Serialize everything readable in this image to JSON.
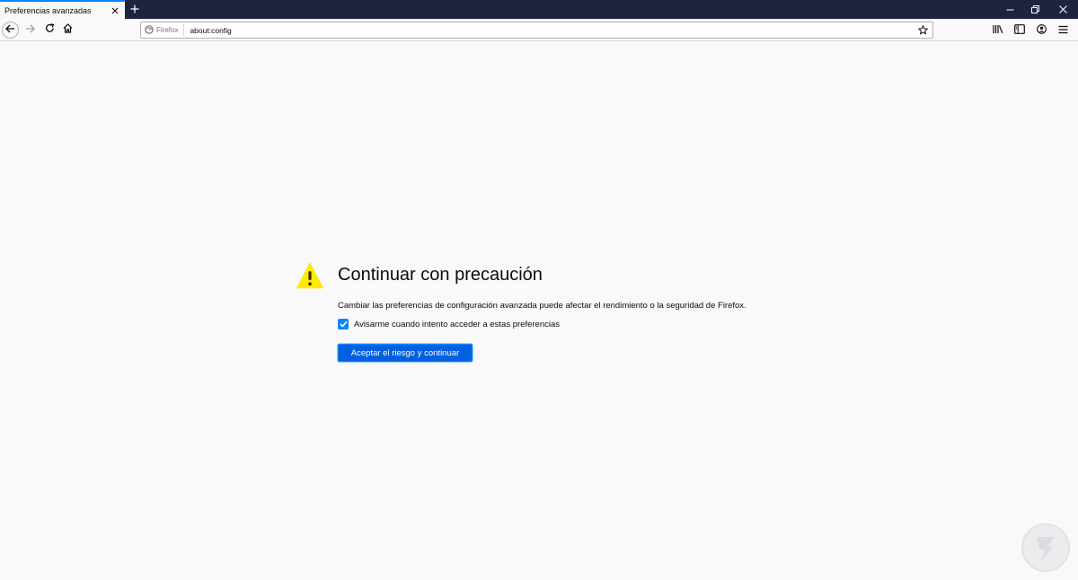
{
  "browser": {
    "tab_title": "Preferencias avanzadas",
    "identity_label": "Firefox",
    "url": "about:config"
  },
  "warning": {
    "title": "Continuar con precaución",
    "description": "Cambiar las preferencias de configuración avanzada puede afectar el rendimiento o la seguridad de Firefox.",
    "checkbox_label": "Avisarme cuando intento acceder a estas preferencias",
    "checkbox_checked": true,
    "button_label": "Aceptar el riesgo y continuar"
  },
  "colors": {
    "tab_strip": "#202340",
    "accent": "#0a84ff",
    "button": "#0060df",
    "warning_icon": "#ffe900",
    "watermark": "#e3e3e6"
  },
  "icons": {
    "back": "arrow-left-icon",
    "forward": "arrow-right-icon",
    "reload": "reload-icon",
    "home": "home-icon",
    "bookmark": "star-icon",
    "library": "library-icon",
    "sidebar": "sidebar-icon",
    "account": "account-icon",
    "menu": "hamburger-menu-icon",
    "warning": "warning-icon"
  }
}
